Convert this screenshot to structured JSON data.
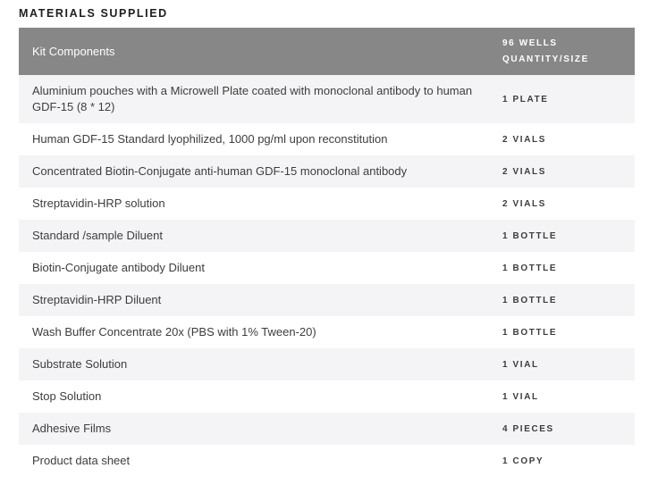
{
  "section": {
    "title": "MATERIALS SUPPLIED"
  },
  "table": {
    "header": {
      "components": "Kit Components",
      "qty_line1": "96 WELLS",
      "qty_line2": "QUANTITY/SIZE"
    },
    "rows": [
      {
        "component": "Aluminium pouches with a Microwell Plate coated with monoclonal antibody to human GDF-15 (8 * 12)",
        "quantity": "1 PLATE"
      },
      {
        "component": "Human GDF-15 Standard lyophilized, 1000 pg/ml upon reconstitution",
        "quantity": "2 VIALS"
      },
      {
        "component": "Concentrated Biotin-Conjugate anti-human GDF-15 monoclonal antibody",
        "quantity": "2 VIALS"
      },
      {
        "component": "Streptavidin-HRP solution",
        "quantity": "2 VIALS"
      },
      {
        "component": "Standard /sample Diluent",
        "quantity": "1 BOTTLE"
      },
      {
        "component": "Biotin-Conjugate antibody Diluent",
        "quantity": "1 BOTTLE"
      },
      {
        "component": "Streptavidin-HRP Diluent",
        "quantity": "1 BOTTLE"
      },
      {
        "component": "Wash Buffer Concentrate 20x (PBS with 1% Tween-20)",
        "quantity": "1 BOTTLE"
      },
      {
        "component": "Substrate Solution",
        "quantity": "1 VIAL"
      },
      {
        "component": "Stop Solution",
        "quantity": "1 VIAL"
      },
      {
        "component": "Adhesive Films",
        "quantity": "4 PIECES"
      },
      {
        "component": "Product data sheet",
        "quantity": "1 COPY"
      }
    ]
  }
}
